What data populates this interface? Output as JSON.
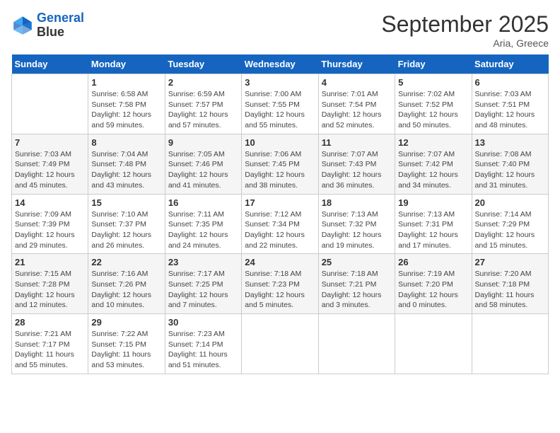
{
  "logo": {
    "line1": "General",
    "line2": "Blue"
  },
  "title": {
    "month_year": "September 2025",
    "location": "Aria, Greece"
  },
  "weekdays": [
    "Sunday",
    "Monday",
    "Tuesday",
    "Wednesday",
    "Thursday",
    "Friday",
    "Saturday"
  ],
  "weeks": [
    [
      {
        "day": "",
        "info": ""
      },
      {
        "day": "1",
        "info": "Sunrise: 6:58 AM\nSunset: 7:58 PM\nDaylight: 12 hours\nand 59 minutes."
      },
      {
        "day": "2",
        "info": "Sunrise: 6:59 AM\nSunset: 7:57 PM\nDaylight: 12 hours\nand 57 minutes."
      },
      {
        "day": "3",
        "info": "Sunrise: 7:00 AM\nSunset: 7:55 PM\nDaylight: 12 hours\nand 55 minutes."
      },
      {
        "day": "4",
        "info": "Sunrise: 7:01 AM\nSunset: 7:54 PM\nDaylight: 12 hours\nand 52 minutes."
      },
      {
        "day": "5",
        "info": "Sunrise: 7:02 AM\nSunset: 7:52 PM\nDaylight: 12 hours\nand 50 minutes."
      },
      {
        "day": "6",
        "info": "Sunrise: 7:03 AM\nSunset: 7:51 PM\nDaylight: 12 hours\nand 48 minutes."
      }
    ],
    [
      {
        "day": "7",
        "info": "Sunrise: 7:03 AM\nSunset: 7:49 PM\nDaylight: 12 hours\nand 45 minutes."
      },
      {
        "day": "8",
        "info": "Sunrise: 7:04 AM\nSunset: 7:48 PM\nDaylight: 12 hours\nand 43 minutes."
      },
      {
        "day": "9",
        "info": "Sunrise: 7:05 AM\nSunset: 7:46 PM\nDaylight: 12 hours\nand 41 minutes."
      },
      {
        "day": "10",
        "info": "Sunrise: 7:06 AM\nSunset: 7:45 PM\nDaylight: 12 hours\nand 38 minutes."
      },
      {
        "day": "11",
        "info": "Sunrise: 7:07 AM\nSunset: 7:43 PM\nDaylight: 12 hours\nand 36 minutes."
      },
      {
        "day": "12",
        "info": "Sunrise: 7:07 AM\nSunset: 7:42 PM\nDaylight: 12 hours\nand 34 minutes."
      },
      {
        "day": "13",
        "info": "Sunrise: 7:08 AM\nSunset: 7:40 PM\nDaylight: 12 hours\nand 31 minutes."
      }
    ],
    [
      {
        "day": "14",
        "info": "Sunrise: 7:09 AM\nSunset: 7:39 PM\nDaylight: 12 hours\nand 29 minutes."
      },
      {
        "day": "15",
        "info": "Sunrise: 7:10 AM\nSunset: 7:37 PM\nDaylight: 12 hours\nand 26 minutes."
      },
      {
        "day": "16",
        "info": "Sunrise: 7:11 AM\nSunset: 7:35 PM\nDaylight: 12 hours\nand 24 minutes."
      },
      {
        "day": "17",
        "info": "Sunrise: 7:12 AM\nSunset: 7:34 PM\nDaylight: 12 hours\nand 22 minutes."
      },
      {
        "day": "18",
        "info": "Sunrise: 7:13 AM\nSunset: 7:32 PM\nDaylight: 12 hours\nand 19 minutes."
      },
      {
        "day": "19",
        "info": "Sunrise: 7:13 AM\nSunset: 7:31 PM\nDaylight: 12 hours\nand 17 minutes."
      },
      {
        "day": "20",
        "info": "Sunrise: 7:14 AM\nSunset: 7:29 PM\nDaylight: 12 hours\nand 15 minutes."
      }
    ],
    [
      {
        "day": "21",
        "info": "Sunrise: 7:15 AM\nSunset: 7:28 PM\nDaylight: 12 hours\nand 12 minutes."
      },
      {
        "day": "22",
        "info": "Sunrise: 7:16 AM\nSunset: 7:26 PM\nDaylight: 12 hours\nand 10 minutes."
      },
      {
        "day": "23",
        "info": "Sunrise: 7:17 AM\nSunset: 7:25 PM\nDaylight: 12 hours\nand 7 minutes."
      },
      {
        "day": "24",
        "info": "Sunrise: 7:18 AM\nSunset: 7:23 PM\nDaylight: 12 hours\nand 5 minutes."
      },
      {
        "day": "25",
        "info": "Sunrise: 7:18 AM\nSunset: 7:21 PM\nDaylight: 12 hours\nand 3 minutes."
      },
      {
        "day": "26",
        "info": "Sunrise: 7:19 AM\nSunset: 7:20 PM\nDaylight: 12 hours\nand 0 minutes."
      },
      {
        "day": "27",
        "info": "Sunrise: 7:20 AM\nSunset: 7:18 PM\nDaylight: 11 hours\nand 58 minutes."
      }
    ],
    [
      {
        "day": "28",
        "info": "Sunrise: 7:21 AM\nSunset: 7:17 PM\nDaylight: 11 hours\nand 55 minutes."
      },
      {
        "day": "29",
        "info": "Sunrise: 7:22 AM\nSunset: 7:15 PM\nDaylight: 11 hours\nand 53 minutes."
      },
      {
        "day": "30",
        "info": "Sunrise: 7:23 AM\nSunset: 7:14 PM\nDaylight: 11 hours\nand 51 minutes."
      },
      {
        "day": "",
        "info": ""
      },
      {
        "day": "",
        "info": ""
      },
      {
        "day": "",
        "info": ""
      },
      {
        "day": "",
        "info": ""
      }
    ]
  ]
}
